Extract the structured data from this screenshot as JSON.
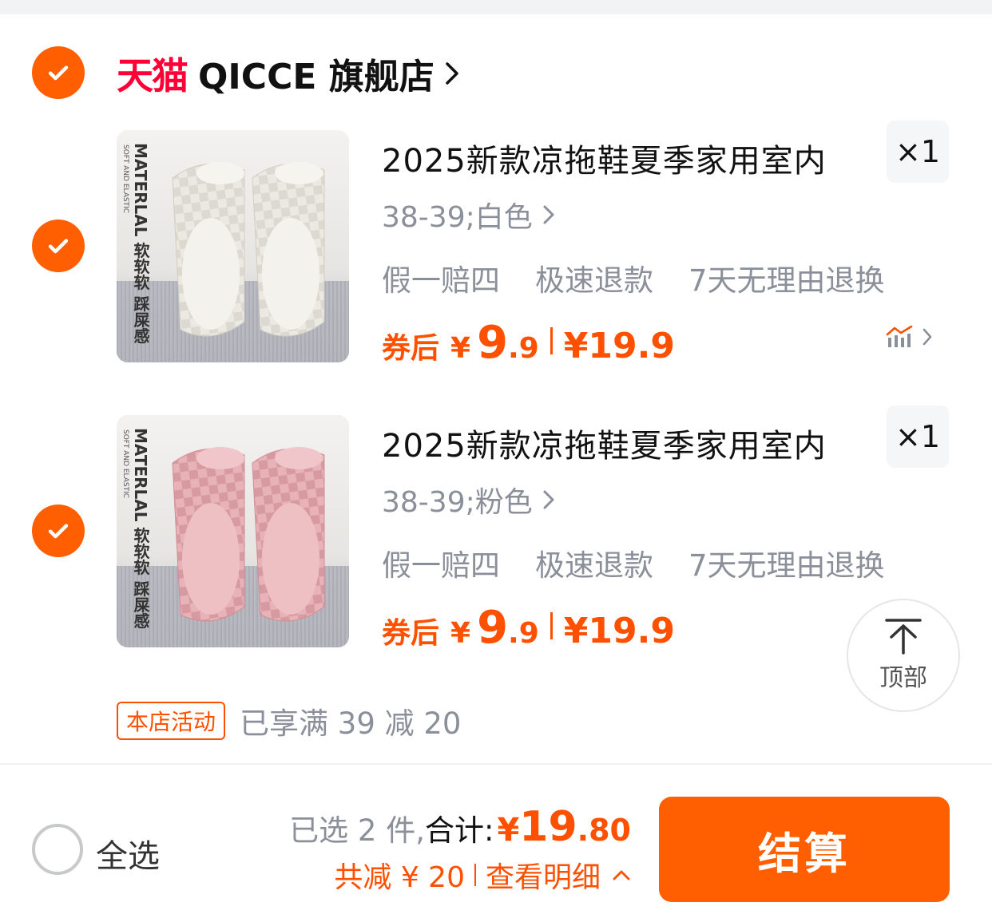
{
  "colors": {
    "accent": "#ff5f00",
    "price": "#ff5000",
    "tmall": "#ff0036",
    "muted": "#8a8f99"
  },
  "store": {
    "tmall_label": "天猫",
    "name": "QICCE 旗舰店",
    "chevron_icon": "chevron-right-icon"
  },
  "items": [
    {
      "title": "2025新款凉拖鞋夏季家用室内",
      "qty": "×1",
      "sku": "38-39;白色",
      "tags": [
        "假一赔四",
        "极速退款",
        "7天无理由退换"
      ],
      "coupon_label": "券后",
      "yen": "¥",
      "price_int": "9",
      "price_dec": ".9",
      "orig_price": "¥19.9",
      "thumb_text": "软软软 踩屎感",
      "thumb_material": "MATERLAL",
      "thumb_small": "SOFT AND ELASTIC",
      "color": "white",
      "trend_icon": "price-trend-icon"
    },
    {
      "title": "2025新款凉拖鞋夏季家用室内",
      "qty": "×1",
      "sku": "38-39;粉色",
      "tags": [
        "假一赔四",
        "极速退款",
        "7天无理由退换"
      ],
      "coupon_label": "券后",
      "yen": "¥",
      "price_int": "9",
      "price_dec": ".9",
      "orig_price": "¥19.9",
      "thumb_text": "软软软 踩屎感",
      "thumb_material": "MATERLAL",
      "thumb_small": "SOFT AND ELASTIC",
      "color": "pink"
    }
  ],
  "promo": {
    "badge": "本店活动",
    "text": "已享满 39 减 20"
  },
  "top_button": {
    "label": "顶部",
    "icon": "arrow-up-icon"
  },
  "bottom": {
    "select_all": "全选",
    "selected": "已选 2 件,",
    "total_label": "合计:",
    "yen": "¥",
    "total_int": "19",
    "total_dec": ".80",
    "discount_label": "共减 ¥ 20",
    "detail_label": "查看明细",
    "checkout_label": "结算"
  }
}
